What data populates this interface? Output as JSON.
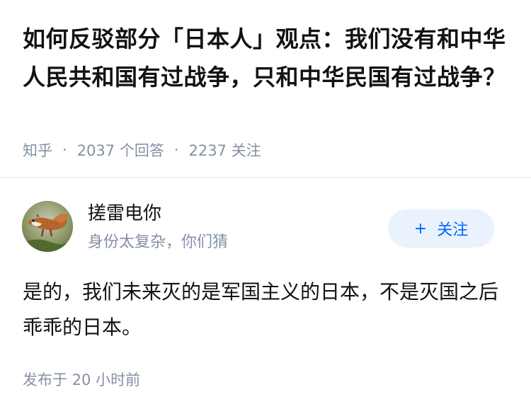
{
  "question": {
    "title": "如何反驳部分「日本人」观点：我们没有和中华人民共和国有过战争，只和中华民国有过战争？",
    "source": "知乎",
    "answers_count": "2037",
    "answers_label": "个回答",
    "followers_count": "2237",
    "followers_label": "关注",
    "separator": "·"
  },
  "author": {
    "name": "搓雷电你",
    "bio": "身份太复杂，你们猜",
    "avatar_icon": "squirrel-avatar-icon",
    "follow_plus": "+",
    "follow_label": "关注"
  },
  "answer": {
    "content": "是的，我们未来灭的是军国主义的日本，不是灭国之后乖乖的日本。",
    "time_prefix": "发布于",
    "time_value": "20 小时前"
  },
  "colors": {
    "title_text": "#121212",
    "meta_text": "#8590a6",
    "follow_button_bg": "#eaf2fd",
    "follow_button_text": "#0066ff",
    "divider": "#f0f2f7"
  }
}
